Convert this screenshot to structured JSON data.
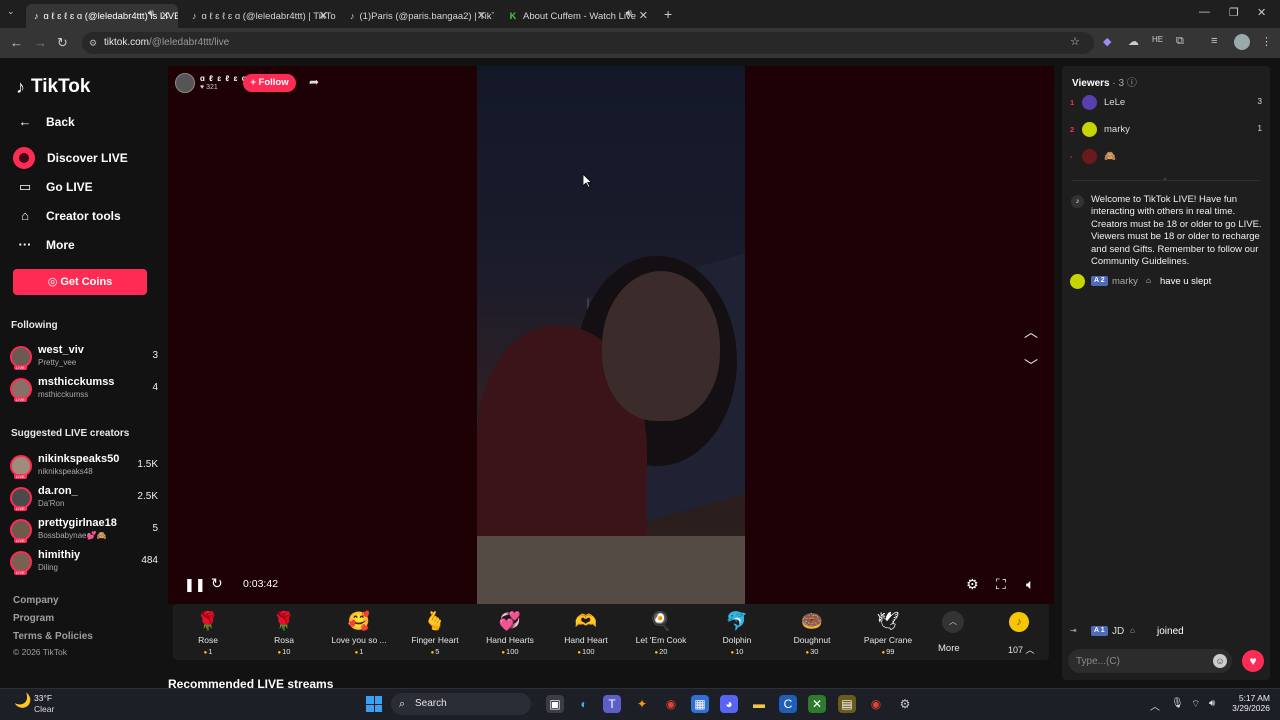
{
  "browser": {
    "tabs": [
      {
        "label": "ɑ ℓ ɛ ℓ ɛ ɑ (@leledabr4ttt) is LIVE",
        "icon": "tiktok-icon",
        "active": true
      },
      {
        "label": "ɑ ℓ ɛ ℓ ɛ ɑ (@leledabr4ttt) | TikTok",
        "icon": "tiktok-icon",
        "active": false
      },
      {
        "label": "(1)Paris (@paris.bangaa2) | TikTok",
        "icon": "tiktok-icon",
        "active": false
      },
      {
        "label": "About Cuffem - Watch Live",
        "icon": "cuffem-icon",
        "active": false
      }
    ],
    "url_host": "tiktok.com",
    "url_path": "/@leledabr4ttt/live"
  },
  "sidebar": {
    "brand": "TikTok",
    "back": "Back",
    "nav": [
      {
        "label": "Discover LIVE",
        "icon": "live-icon"
      },
      {
        "label": "Go LIVE",
        "icon": "camera-icon"
      },
      {
        "label": "Creator tools",
        "icon": "home-icon"
      },
      {
        "label": "More",
        "icon": "more-icon"
      }
    ],
    "get_coins": "Get Coins",
    "following_title": "Following",
    "following": [
      {
        "name": "west_viv",
        "sub": "Pretty_vee",
        "count": "3"
      },
      {
        "name": "msthicckumss",
        "sub": "msthicckumss",
        "count": "4"
      }
    ],
    "suggested_title": "Suggested LIVE creators",
    "suggested": [
      {
        "name": "nikinkspeaks50",
        "sub": "niknikspeaks48",
        "count": "1.5K"
      },
      {
        "name": "da.ron_",
        "sub": "Da'Ron",
        "count": "2.5K"
      },
      {
        "name": "prettygirlnae18",
        "sub": "Bossbabynae💕🙈",
        "count": "5"
      },
      {
        "name": "himithiy",
        "sub": "Diling",
        "count": "484"
      }
    ],
    "footer": [
      "Company",
      "Program",
      "Terms & Policies"
    ],
    "copyright": "© 2026 TikTok"
  },
  "stream": {
    "host_name": "ɑ ℓ ɛ ℓ ɛ ɑ",
    "host_likes": "♥ 321",
    "follow": "+ Follow",
    "elapsed": "0:03:42"
  },
  "gifts": [
    {
      "name": "Rose",
      "price": "1",
      "icon": "🌹"
    },
    {
      "name": "Rosa",
      "price": "10",
      "icon": "🌹"
    },
    {
      "name": "Love you so ...",
      "price": "1",
      "icon": "🥰"
    },
    {
      "name": "Finger Heart",
      "price": "5",
      "icon": "🫰"
    },
    {
      "name": "Hand Hearts",
      "price": "100",
      "icon": "💞"
    },
    {
      "name": "Hand Heart",
      "price": "100",
      "icon": "🫶"
    },
    {
      "name": "Let 'Em Cook",
      "price": "20",
      "icon": "🍳"
    },
    {
      "name": "Dolphin",
      "price": "10",
      "icon": "🐬"
    },
    {
      "name": "Doughnut",
      "price": "30",
      "icon": "🍩"
    },
    {
      "name": "Paper Crane",
      "price": "99",
      "icon": "🕊"
    }
  ],
  "gift_more": "More",
  "coin_balance": "107",
  "recommended": "Recommended LIVE streams",
  "chat": {
    "viewers_title": "Viewers",
    "viewers_count": "· 3",
    "viewers": [
      {
        "rank": "1",
        "name": "LeLe",
        "score": "3",
        "color": "#5a3fb0"
      },
      {
        "rank": "2",
        "name": "marky",
        "score": "1",
        "color": "#c8d400"
      },
      {
        "rank": "-",
        "name": "🙈",
        "score": "",
        "color": "#6a1a1a"
      }
    ],
    "welcome": "Welcome to TikTok LIVE! Have fun interacting with others in real time. Creators must be 18 or older to go LIVE. Viewers must be 18 or older to recharge and send Gifts. Remember to follow our Community Guidelines.",
    "message": {
      "badge": "A 2",
      "user": "marky",
      "text": "have u slept"
    },
    "joined": {
      "badge": "A 1",
      "user": "JD",
      "text": "joined"
    },
    "input_placeholder": "Type...(C)"
  },
  "taskbar": {
    "temp": "33°F",
    "condition": "Clear",
    "search": "Search",
    "time": "5:17 AM",
    "date": "3/29/2026"
  }
}
